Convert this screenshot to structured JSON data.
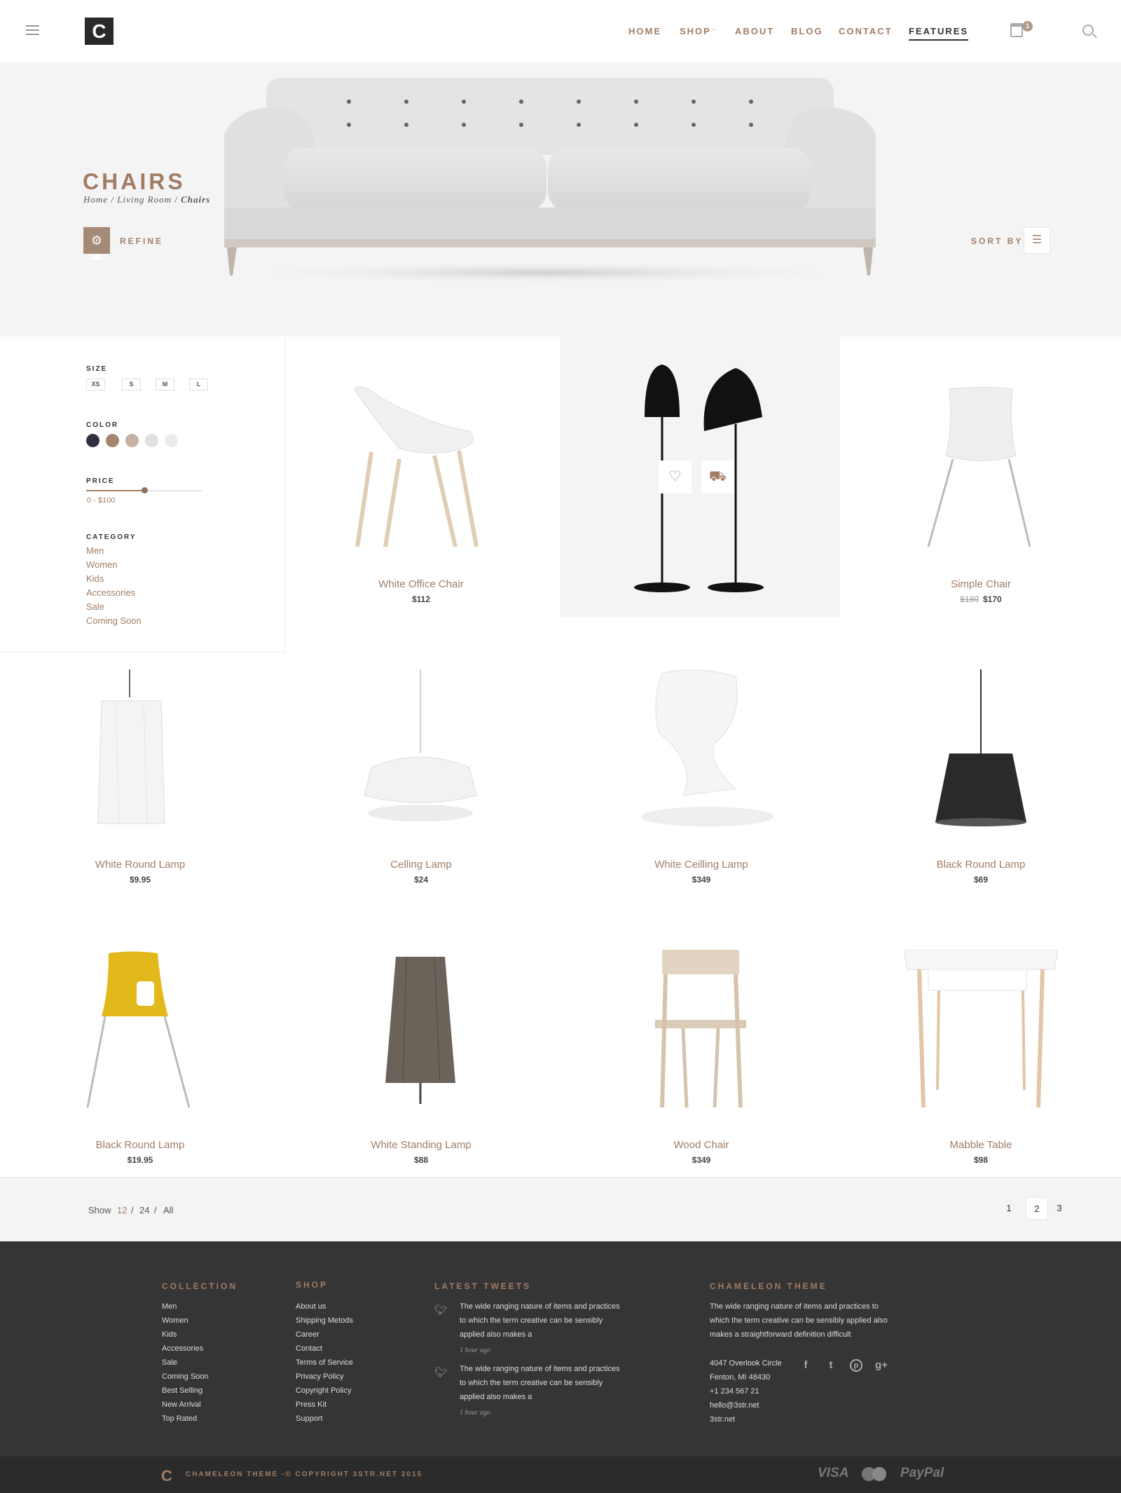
{
  "header": {
    "logo": "C",
    "nav": [
      "HOME",
      "SHOP",
      "ABOUT",
      "BLOG",
      "CONTACT",
      "FEATURES"
    ],
    "cart_count": "1"
  },
  "hero": {
    "title": "CHAIRS",
    "breadcrumb": [
      "Home",
      "Living Room",
      "Chairs"
    ],
    "refine_label": "REFINE",
    "sort_label": "SORT BY"
  },
  "filters": {
    "size_heading": "SIZE",
    "sizes": [
      "XS",
      "S",
      "M",
      "L"
    ],
    "color_heading": "COLOR",
    "colors": [
      "#2f3140",
      "#a4876f",
      "#c6b1a2",
      "#e0e0e0",
      "#ececec"
    ],
    "price_heading": "PRICE",
    "price_range": "0 - $100",
    "price_level": 0.5,
    "category_heading": "CATEGORY",
    "categories": [
      "Men",
      "Women",
      "Kids",
      "Accessories",
      "Sale",
      "Coming Soon"
    ]
  },
  "products": [
    {
      "name": "White Office Chair",
      "price": "$112"
    },
    {
      "name": "",
      "price": ""
    },
    {
      "name": "Simple Chair",
      "old_price": "$180",
      "price": "$170"
    },
    {
      "name": "White Round Lamp",
      "price": "$9.95"
    },
    {
      "name": "Celling Lamp",
      "price": "$24"
    },
    {
      "name": "White Ceilling Lamp",
      "price": "$349"
    },
    {
      "name": "Black Round Lamp",
      "price": "$69"
    },
    {
      "name": "Black Round Lamp",
      "price": "$19.95"
    },
    {
      "name": "White Standing Lamp",
      "price": "$88"
    },
    {
      "name": "Wood Chair",
      "price": "$349"
    },
    {
      "name": "Mabble Table",
      "price": "$98"
    }
  ],
  "pagination": {
    "show_label": "Show",
    "options": [
      "12",
      "24",
      "All"
    ],
    "pages": [
      "1",
      "2",
      "3"
    ],
    "active_page": "2"
  },
  "footer": {
    "collection_heading": "COLLECTION",
    "collection": [
      "Men",
      "Women",
      "Kids",
      "Accessories",
      "Sale",
      "Coming Soon",
      "Best Selling",
      "New Arrival",
      "Top Rated"
    ],
    "shop_heading": "SHOP",
    "shop": [
      "About us",
      "Shipping Metods",
      "Career",
      "Contact",
      "Terms of Service",
      "Privacy Policy",
      "Copyright Policy",
      "Press Kit",
      "Support"
    ],
    "tweets_heading": "LATEST TWEETS",
    "tweets": [
      {
        "text": "The wide ranging nature of items and practices to which the term creative can be sensibly applied also makes a",
        "time": "1 hour ago"
      },
      {
        "text": "The wide ranging nature of items and practices to which the term creative can be sensibly applied also makes a",
        "time": "1 hour ago"
      }
    ],
    "about_heading": "CHAMELEON THEME",
    "about_text": "The wide ranging nature of items and practices to which the term creative can be sensibly applied also makes a straightforward definition difficult",
    "contact": [
      "4047 Overlook Circle",
      "Fenton, MI 48430",
      "+1 234 567 21",
      "hello@3str.net",
      "3str.net"
    ],
    "copyright": "CHAMELEON THEME -© COPYRIGHT 3STR.NET 2015",
    "payments": [
      "VISA",
      "PayPal"
    ]
  }
}
